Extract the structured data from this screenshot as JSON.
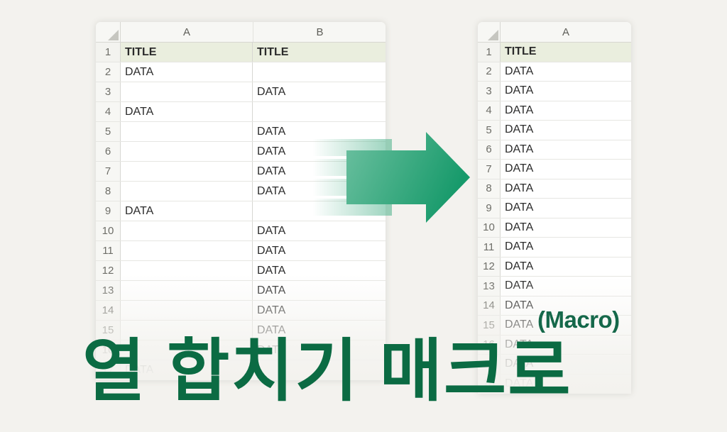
{
  "background_color": "#f3f2ee",
  "accent_color": "#0b6b43",
  "arrow_color_start": "#5bb894",
  "arrow_color_end": "#1e9e6f",
  "title_cell_fill": "#eaeede",
  "title": {
    "korean": "열 합치기 매크로",
    "macro_label": "(Macro)"
  },
  "left_sheet": {
    "name": "source-sheet",
    "corner_icon": "select-all-triangle-icon",
    "columns": [
      "A",
      "B"
    ],
    "rows": [
      {
        "num": "1",
        "a": "TITLE",
        "b": "TITLE",
        "is_title": true,
        "opacity": 1
      },
      {
        "num": "2",
        "a": "DATA",
        "b": "",
        "is_title": false,
        "opacity": 1
      },
      {
        "num": "3",
        "a": "",
        "b": "DATA",
        "is_title": false,
        "opacity": 1
      },
      {
        "num": "4",
        "a": "DATA",
        "b": "",
        "is_title": false,
        "opacity": 1
      },
      {
        "num": "5",
        "a": "",
        "b": "DATA",
        "is_title": false,
        "opacity": 1
      },
      {
        "num": "6",
        "a": "",
        "b": "DATA",
        "is_title": false,
        "opacity": 1
      },
      {
        "num": "7",
        "a": "",
        "b": "DATA",
        "is_title": false,
        "opacity": 1
      },
      {
        "num": "8",
        "a": "",
        "b": "DATA",
        "is_title": false,
        "opacity": 1
      },
      {
        "num": "9",
        "a": "DATA",
        "b": "",
        "is_title": false,
        "opacity": 1
      },
      {
        "num": "10",
        "a": "",
        "b": "DATA",
        "is_title": false,
        "opacity": 1
      },
      {
        "num": "11",
        "a": "",
        "b": "DATA",
        "is_title": false,
        "opacity": 1
      },
      {
        "num": "12",
        "a": "",
        "b": "DATA",
        "is_title": false,
        "opacity": 1
      },
      {
        "num": "13",
        "a": "",
        "b": "DATA",
        "is_title": false,
        "opacity": 1
      },
      {
        "num": "14",
        "a": "",
        "b": "DATA",
        "is_title": false,
        "opacity": 1
      },
      {
        "num": "15",
        "a": "",
        "b": "DATA",
        "is_title": false,
        "opacity": 1
      },
      {
        "num": "16",
        "a": "",
        "b": "DATA",
        "is_title": false,
        "opacity": 1
      },
      {
        "num": "17",
        "a": "DATA",
        "b": "",
        "is_title": false,
        "opacity": 1
      }
    ]
  },
  "right_sheet": {
    "name": "result-sheet",
    "corner_icon": "select-all-triangle-icon",
    "columns": [
      "A"
    ],
    "rows": [
      {
        "num": "1",
        "a": "TITLE",
        "is_title": true
      },
      {
        "num": "2",
        "a": "DATA",
        "is_title": false
      },
      {
        "num": "3",
        "a": "DATA",
        "is_title": false
      },
      {
        "num": "4",
        "a": "DATA",
        "is_title": false
      },
      {
        "num": "5",
        "a": "DATA",
        "is_title": false
      },
      {
        "num": "6",
        "a": "DATA",
        "is_title": false
      },
      {
        "num": "7",
        "a": "DATA",
        "is_title": false
      },
      {
        "num": "8",
        "a": "DATA",
        "is_title": false
      },
      {
        "num": "9",
        "a": "DATA",
        "is_title": false
      },
      {
        "num": "10",
        "a": "DATA",
        "is_title": false
      },
      {
        "num": "11",
        "a": "DATA",
        "is_title": false
      },
      {
        "num": "12",
        "a": "DATA",
        "is_title": false
      },
      {
        "num": "13",
        "a": "DATA",
        "is_title": false
      },
      {
        "num": "14",
        "a": "DATA",
        "is_title": false
      },
      {
        "num": "15",
        "a": "DATA",
        "is_title": false
      },
      {
        "num": "16",
        "a": "DATA",
        "is_title": false
      },
      {
        "num": "17",
        "a": "DATA",
        "is_title": false
      },
      {
        "num": "18",
        "a": "DATA",
        "is_title": false
      }
    ]
  },
  "arrow": {
    "name": "transform-arrow",
    "direction": "right",
    "tail_label": "",
    "has_motion_tail": true
  }
}
